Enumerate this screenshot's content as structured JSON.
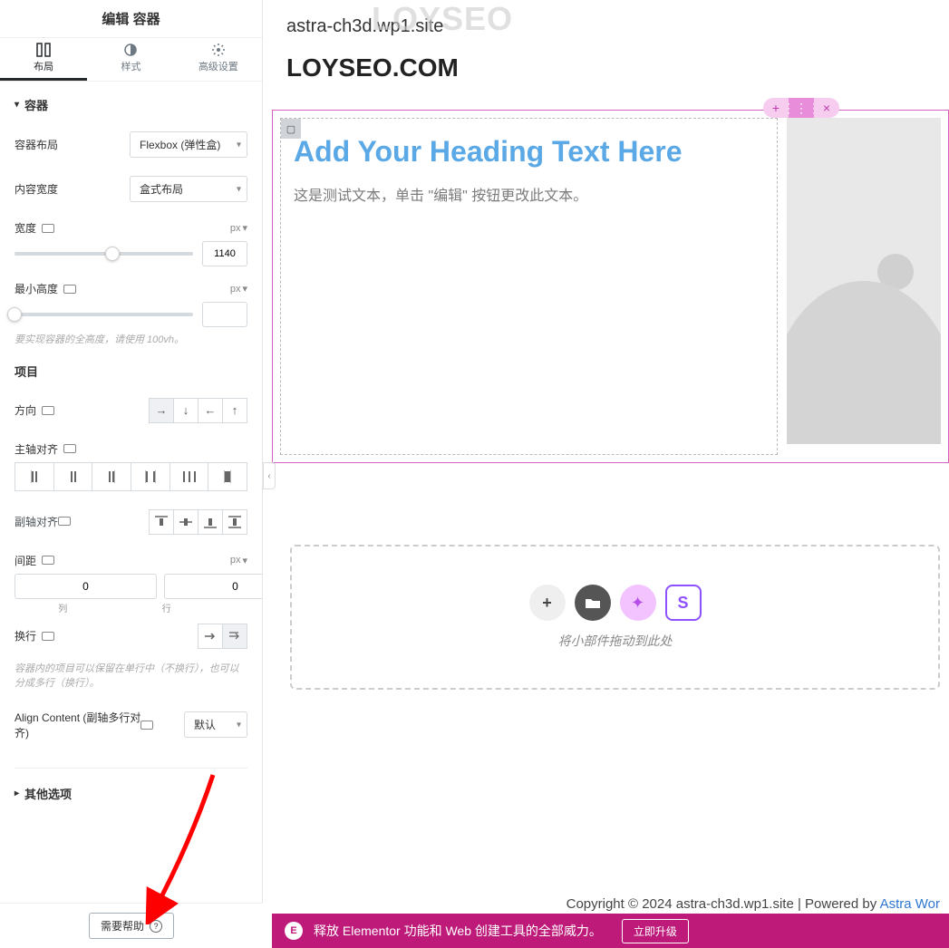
{
  "sidebar": {
    "title": "编辑 容器",
    "tabs": {
      "layout": "布局",
      "style": "样式",
      "advanced": "高级设置"
    },
    "sections": {
      "container": {
        "title": "容器",
        "container_layout_label": "容器布局",
        "container_layout_value": "Flexbox (弹性盒)",
        "content_width_label": "内容宽度",
        "content_width_value": "盒式布局",
        "width_label": "宽度",
        "width_unit": "px",
        "width_value": "1140",
        "min_height_label": "最小高度",
        "min_height_unit": "px",
        "min_height_value": "",
        "min_height_hint": "要实现容器的全高度，请使用 100vh。"
      },
      "items": {
        "title": "项目",
        "direction_label": "方向",
        "justify_label": "主轴对齐",
        "align_label": "副轴对齐",
        "gap_label": "间距",
        "gap_unit": "px",
        "gap_col_value": "0",
        "gap_row_value": "0",
        "gap_col_lbl": "列",
        "gap_row_lbl": "行",
        "wrap_label": "换行",
        "wrap_hint": "容器内的项目可以保留在单行中（不换行），也可以分成多行（换行）。",
        "align_content_label": "Align Content (副轴多行对齐)",
        "align_content_value": "默认"
      },
      "other": {
        "title": "其他选项"
      }
    },
    "help_label": "需要帮助"
  },
  "main": {
    "url": "astra-ch3d.wp1.site",
    "watermark": "LOYSEO",
    "site_name": "LOYSEO.COM",
    "heading_placeholder": "Add Your Heading Text Here",
    "text_placeholder": "这是测试文本，单击 \"编辑\" 按钮更改此文本。",
    "drop_text": "将小部件拖动到此处",
    "copyright_pre": "Copyright © 2024 astra-ch3d.wp1.site | Powered by ",
    "copyright_link": "Astra Wor",
    "promo_text": "释放 Elementor 功能和 Web 创建工具的全部威力。",
    "promo_btn": "立即升级"
  }
}
